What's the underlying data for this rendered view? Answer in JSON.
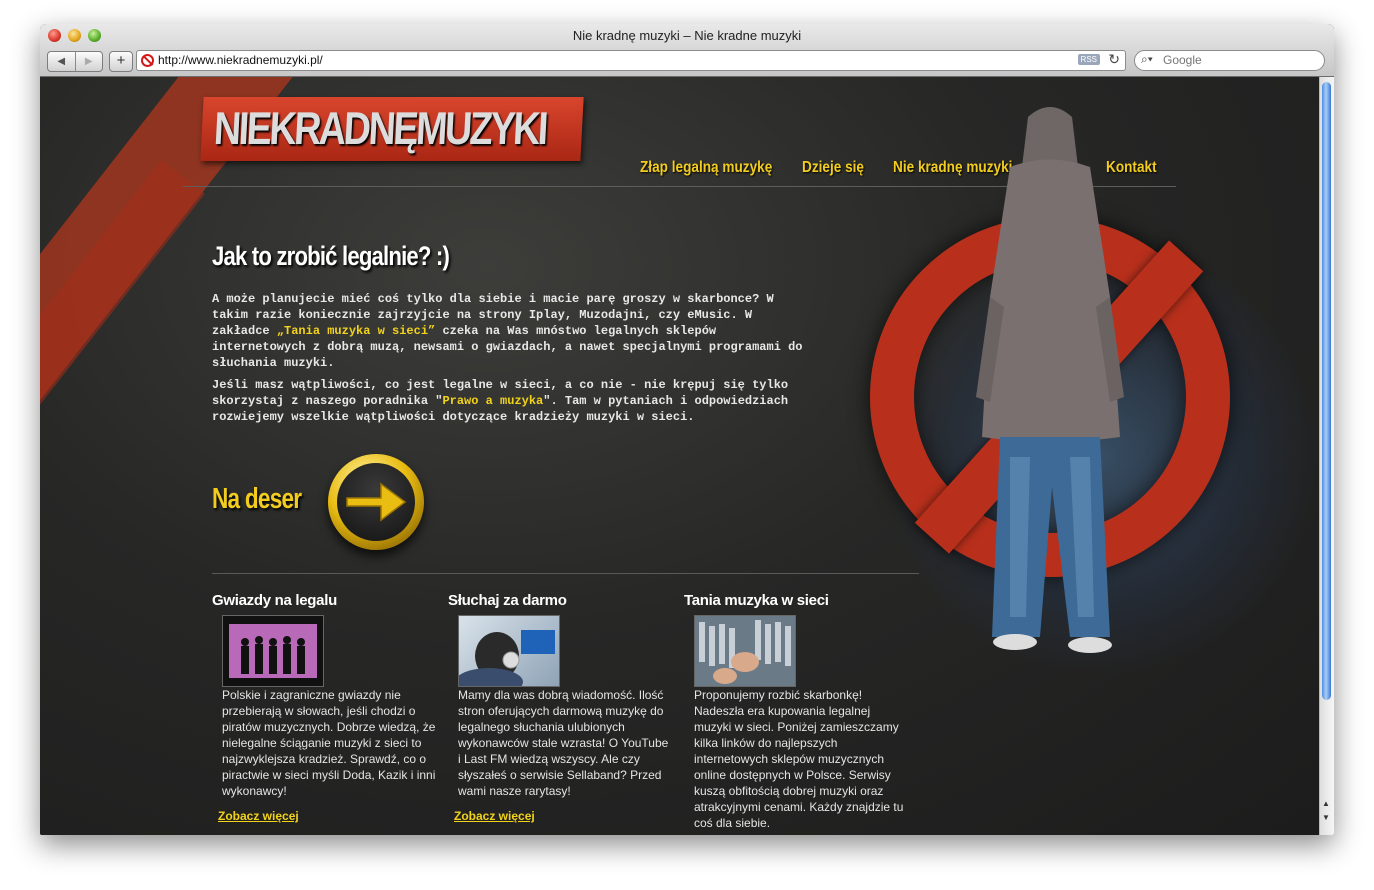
{
  "browser": {
    "window_title": "Nie kradnę muzyki – Nie kradne muzyki",
    "url": "http://www.niekradnemuzyki.pl/",
    "rss_label": "RSS",
    "search_placeholder": "Google",
    "nav_back": "◀",
    "nav_forward": "▶",
    "add_label": "+"
  },
  "site": {
    "logo_text": "NIEKRADNĘMUZYKI",
    "nav": [
      "Złap legalną muzykę",
      "Dzieje się",
      "Nie kradnę muzyki",
      "Kontakt"
    ],
    "headline": "Jak to zrobić legalnie? :)",
    "intro": {
      "p1_a": "A może planujecie mieć coś tylko dla siebie i macie parę groszy w skarbonce? W takim razie koniecznie zajrzyjcie na strony Iplay, Muzodajni, czy eMusic. W zakładce ",
      "p1_link": "„Tania muzyka w sieci”",
      "p1_b": " czeka na Was mnóstwo legalnych sklepów internetowych z dobrą muzą, newsami o gwiazdach, a nawet specjalnymi programami do słuchania muzyki.",
      "p2_a": "Jeśli masz wątpliwości, co jest legalne w sieci, a co nie - nie krępuj się tylko skorzystaj z naszego poradnika \"",
      "p2_link": "Prawo a muzyka",
      "p2_b": "\". Tam w pytaniach i odpowiedziach rozwiejemy wszelkie wątpliwości dotyczące kradzieży muzyki w sieci."
    },
    "deser_label": "Na deser",
    "columns": [
      {
        "title": "Gwiazdy na legalu",
        "text": "Polskie i zagraniczne gwiazdy nie przebierają w słowach, jeśli chodzi o piratów muzycznych. Dobrze wiedzą, że nielegalne ściąganie muzyki z sieci to najzwyklejsza kradzież. Sprawdź, co o piractwie w sieci myśli Doda, Kazik i inni wykonawcy!",
        "link": "Zobacz więcej"
      },
      {
        "title": "Słuchaj za darmo",
        "text": "Mamy dla was dobrą wiadomość. Ilość stron oferujących darmową muzykę do legalnego słuchania ulubionych wykonawców stale wzrasta! O YouTube i Last FM wiedzą wszyscy. Ale czy słyszałeś o serwisie Sellaband? Przed wami nasze rarytasy!",
        "link": "Zobacz więcej"
      },
      {
        "title": "Tania muzyka w sieci",
        "text": "Proponujemy rozbić skarbonkę! Nadeszła era kupowania legalnej muzyki w sieci. Poniżej zamieszczamy kilka linków do najlepszych internetowych sklepów muzycznych online dostępnych w Polsce. Serwisy kuszą obfitością dobrej muzyki oraz atrakcyjnymi cenami. Każdy znajdzie tu coś dla siebie.",
        "link": ""
      }
    ],
    "colors": {
      "accent": "#f2cc1e",
      "brand_red": "#b8301c",
      "bg": "#1f1f1f"
    }
  }
}
